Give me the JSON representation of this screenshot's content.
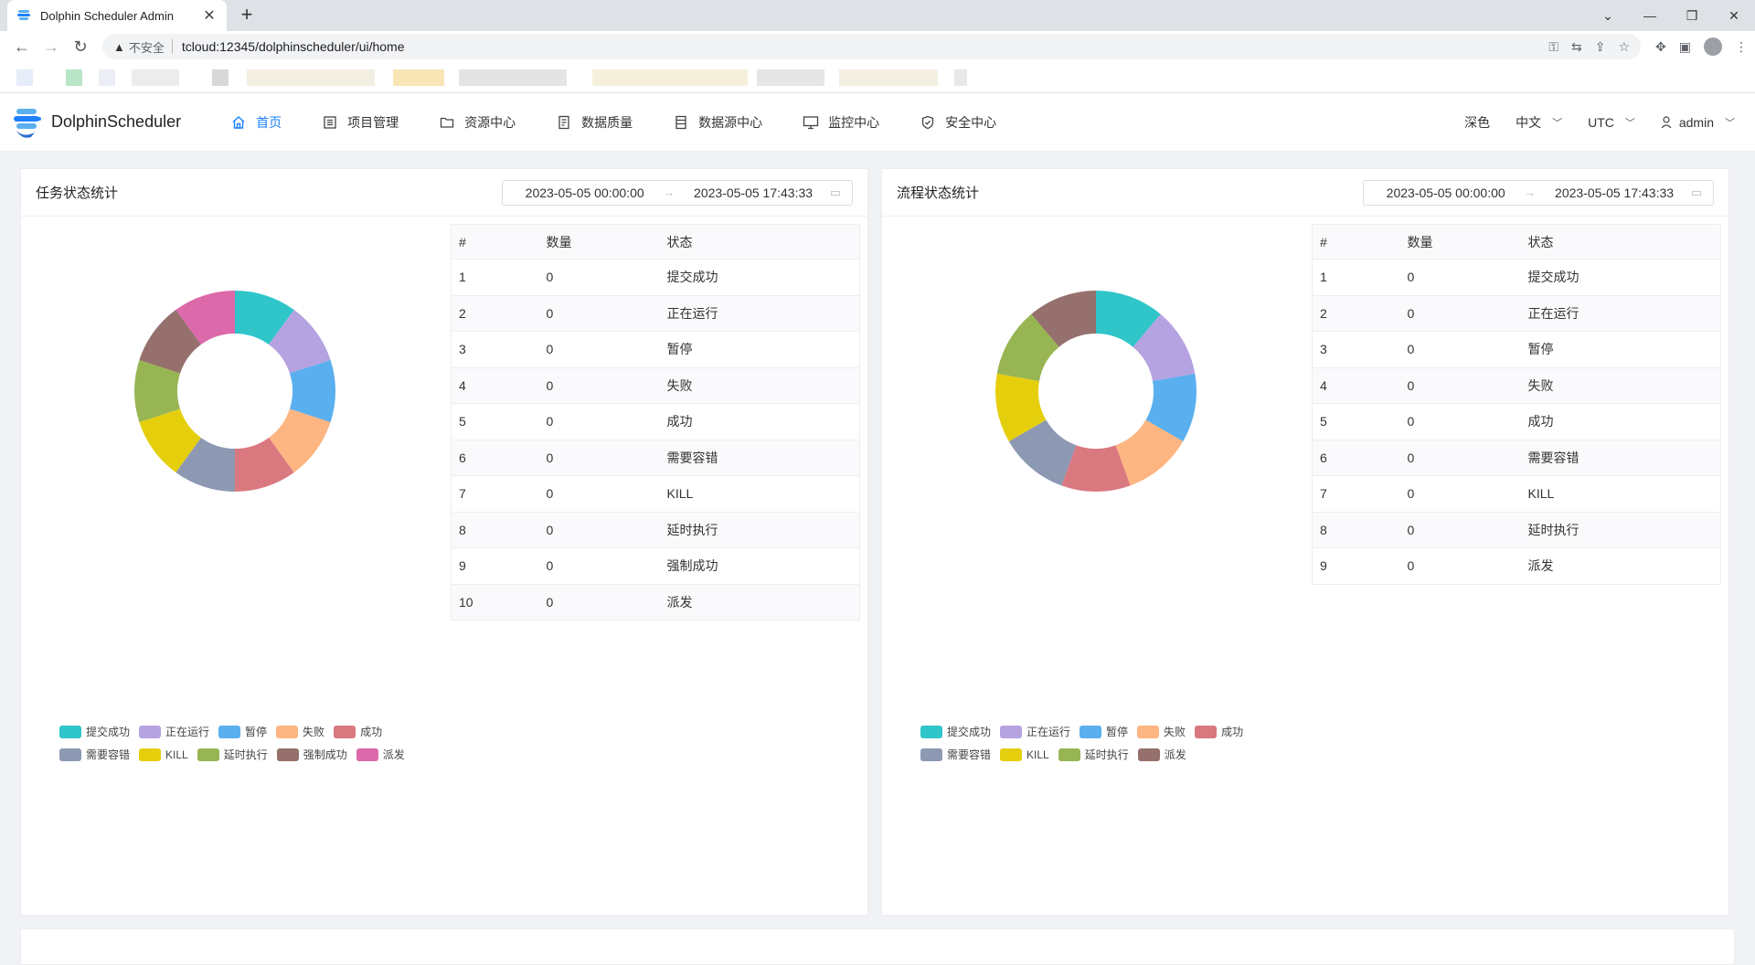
{
  "browser": {
    "tab_title": "Dolphin Scheduler Admin",
    "omni_warning": "不安全",
    "url": "tcloud:12345/dolphinscheduler/ui/home"
  },
  "app": {
    "logo_text": "DolphinScheduler",
    "menu": [
      {
        "label": "首页",
        "icon": "home-icon"
      },
      {
        "label": "项目管理",
        "icon": "project-icon"
      },
      {
        "label": "资源中心",
        "icon": "folder-icon"
      },
      {
        "label": "数据质量",
        "icon": "data-quality-icon"
      },
      {
        "label": "数据源中心",
        "icon": "datasource-icon"
      },
      {
        "label": "监控中心",
        "icon": "monitor-icon"
      },
      {
        "label": "安全中心",
        "icon": "shield-icon"
      }
    ],
    "theme": "深色",
    "language": "中文",
    "timezone": "UTC",
    "user": "admin"
  },
  "colors": {
    "accent": "#1e80ff",
    "palette": [
      "#2fc5c9",
      "#b5a2e0",
      "#5aafef",
      "#fdb581",
      "#da787f",
      "#8d98b3",
      "#e5cf0d",
      "#97b552",
      "#95706d",
      "#dc69aa"
    ]
  },
  "task_card": {
    "title": "任务状态统计",
    "start": "2023-05-05 00:00:00",
    "end": "2023-05-05 17:43:33",
    "headers": [
      "#",
      "数量",
      "状态"
    ],
    "rows": [
      [
        "1",
        "0",
        "提交成功"
      ],
      [
        "2",
        "0",
        "正在运行"
      ],
      [
        "3",
        "0",
        "暂停"
      ],
      [
        "4",
        "0",
        "失败"
      ],
      [
        "5",
        "0",
        "成功"
      ],
      [
        "6",
        "0",
        "需要容错"
      ],
      [
        "7",
        "0",
        "KILL"
      ],
      [
        "8",
        "0",
        "延时执行"
      ],
      [
        "9",
        "0",
        "强制成功"
      ],
      [
        "10",
        "0",
        "派发"
      ]
    ],
    "legend": [
      "提交成功",
      "正在运行",
      "暂停",
      "失败",
      "成功",
      "需要容错",
      "KILL",
      "延时执行",
      "强制成功",
      "派发"
    ]
  },
  "process_card": {
    "title": "流程状态统计",
    "start": "2023-05-05 00:00:00",
    "end": "2023-05-05 17:43:33",
    "headers": [
      "#",
      "数量",
      "状态"
    ],
    "rows": [
      [
        "1",
        "0",
        "提交成功"
      ],
      [
        "2",
        "0",
        "正在运行"
      ],
      [
        "3",
        "0",
        "暂停"
      ],
      [
        "4",
        "0",
        "失败"
      ],
      [
        "5",
        "0",
        "成功"
      ],
      [
        "6",
        "0",
        "需要容错"
      ],
      [
        "7",
        "0",
        "KILL"
      ],
      [
        "8",
        "0",
        "延时执行"
      ],
      [
        "9",
        "0",
        "派发"
      ]
    ],
    "legend": [
      "提交成功",
      "正在运行",
      "暂停",
      "失败",
      "成功",
      "需要容错",
      "KILL",
      "延时执行",
      "派发"
    ]
  }
}
